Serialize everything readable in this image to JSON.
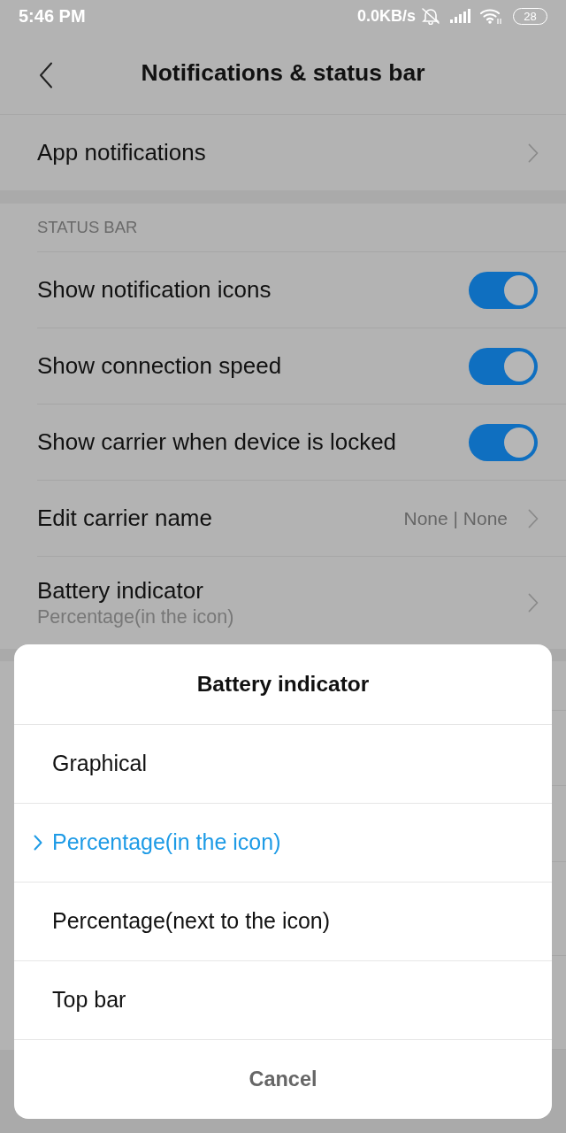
{
  "status_bar": {
    "time": "5:46 PM",
    "network_speed": "0.0KB/s",
    "battery": "28"
  },
  "header": {
    "title": "Notifications & status bar"
  },
  "top_items": [
    {
      "kind": "link",
      "label": "App notifications"
    }
  ],
  "status_section": {
    "heading": "STATUS BAR",
    "items": [
      {
        "kind": "toggle",
        "label": "Show notification icons",
        "on": true
      },
      {
        "kind": "toggle",
        "label": "Show connection speed",
        "on": true
      },
      {
        "kind": "toggle",
        "label": "Show carrier when device is locked",
        "on": true
      },
      {
        "kind": "link",
        "label": "Edit carrier name",
        "value": "None | None"
      },
      {
        "kind": "link",
        "label": "Battery indicator",
        "subtitle": "Percentage(in the icon)"
      }
    ]
  },
  "dialog": {
    "title": "Battery indicator",
    "options": [
      {
        "label": "Graphical",
        "selected": false
      },
      {
        "label": "Percentage(in the icon)",
        "selected": true
      },
      {
        "label": "Percentage(next to the icon)",
        "selected": false
      },
      {
        "label": "Top bar",
        "selected": false
      }
    ],
    "cancel": "Cancel"
  }
}
